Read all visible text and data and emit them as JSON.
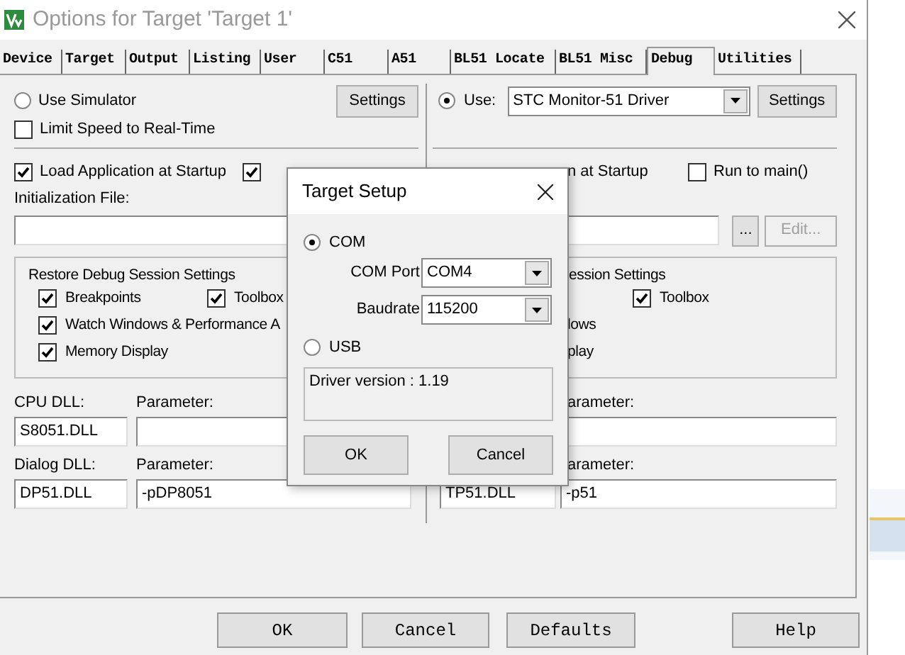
{
  "window": {
    "title": "Options for Target 'Target 1'"
  },
  "tabs": [
    {
      "label": "Device",
      "selected": false
    },
    {
      "label": "Target",
      "selected": false
    },
    {
      "label": "Output",
      "selected": false
    },
    {
      "label": "Listing",
      "selected": false
    },
    {
      "label": "User",
      "selected": false
    },
    {
      "label": "C51",
      "selected": false
    },
    {
      "label": "A51",
      "selected": false
    },
    {
      "label": "BL51 Locate",
      "selected": false
    },
    {
      "label": "BL51 Misc",
      "selected": false
    },
    {
      "label": "Debug",
      "selected": true
    },
    {
      "label": "Utilities",
      "selected": false
    }
  ],
  "left": {
    "simulator": {
      "label": "Use Simulator",
      "selected": false
    },
    "settings_button": "Settings",
    "limit_speed": {
      "label": "Limit Speed to Real-Time",
      "checked": false
    },
    "load_app": {
      "label": "Load Application at Startup",
      "checked": true
    },
    "run_to_main": {
      "checked": true
    },
    "init_label": "Initialization File:",
    "restore": {
      "title": "Restore Debug Session Settings",
      "items": [
        {
          "label": "Breakpoints",
          "checked": true
        },
        {
          "label": "Toolbox",
          "checked": true
        },
        {
          "label": "Watch Windows & Performance A",
          "checked": true
        },
        {
          "label": "Memory Display",
          "checked": true
        }
      ]
    },
    "cpu_dll_label": "CPU DLL:",
    "cpu_dll": "S8051.DLL",
    "cpu_param_label": "Parameter:",
    "dialog_dll_label": "Dialog DLL:",
    "dialog_dll": "DP51.DLL",
    "dialog_param_label": "Parameter:",
    "dialog_param": "-pDP8051"
  },
  "right": {
    "use": {
      "label": "Use:",
      "selected": true
    },
    "driver": "STC Monitor-51 Driver",
    "settings_button": "Settings",
    "load_app_fragment": "n at Startup",
    "run_to_main": {
      "label": "Run to main()",
      "checked": false
    },
    "browse_button": "...",
    "edit_button": {
      "label": "Edit...",
      "disabled": true
    },
    "restore": {
      "title_fragment": "ession Settings",
      "items": [
        {
          "kind": "checkbox",
          "label": "Toolbox",
          "checked": true
        },
        {
          "kind": "fragment",
          "label": "lows"
        },
        {
          "kind": "fragment",
          "label": "play"
        }
      ]
    },
    "cpu_param_label": "arameter:",
    "dialog_param_label": "arameter:",
    "dialog_dll": "TP51.DLL",
    "dialog_param": "-p51"
  },
  "target_setup": {
    "title": "Target Setup",
    "com": {
      "label": "COM",
      "selected": true
    },
    "com_port_label": "COM Port",
    "com_port": "COM4",
    "baudrate_label": "Baudrate",
    "baudrate": "115200",
    "usb": {
      "label": "USB",
      "selected": false
    },
    "driver_version": "Driver version : 1.19",
    "ok_button": "OK",
    "cancel_button": "Cancel"
  },
  "buttons": [
    "OK",
    "Cancel",
    "Defaults",
    "Help"
  ]
}
